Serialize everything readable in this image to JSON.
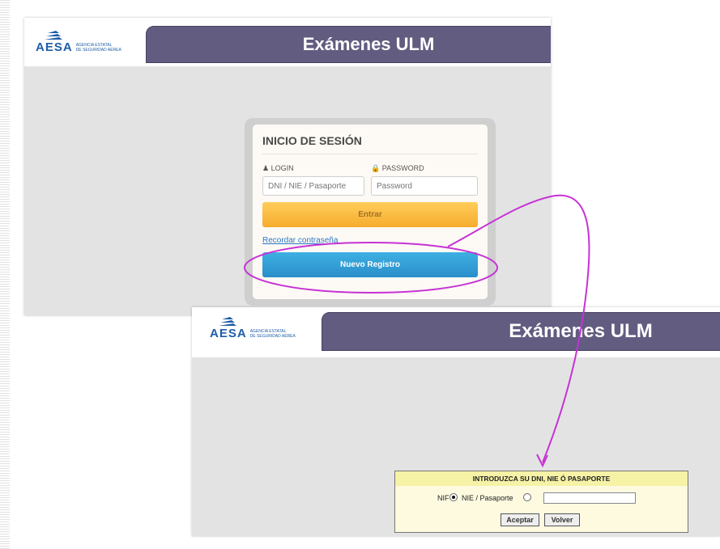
{
  "logo": {
    "word": "AESA",
    "subtitle_line1": "Agencia Estatal",
    "subtitle_line2": "de Seguridad Aérea"
  },
  "top_screen": {
    "title": "Exámenes ULM",
    "login": {
      "heading": "INICIO DE SESIÓN",
      "login_label": "LOGIN",
      "password_label": "PASSWORD",
      "login_placeholder": "DNI / NIE / Pasaporte",
      "password_placeholder": "Password",
      "enter_button": "Entrar",
      "forgot_link": "Recordar contraseña",
      "register_button": "Nuevo Registro"
    }
  },
  "bottom_screen": {
    "title": "Exámenes ULM",
    "form": {
      "heading": "INTRODUZCA SU DNI, NIE Ó PASAPORTE",
      "option_nif": "NIF",
      "option_nie": "NIE / Pasaporte",
      "selected_option": "NIF",
      "accept_button": "Aceptar",
      "back_button": "Volver"
    }
  },
  "annotation": {
    "color": "#c632d6",
    "shapes": [
      "ellipse around Nuevo Registro button",
      "arrow to DNI form"
    ]
  },
  "colors": {
    "title_bar": "#625c80",
    "enter_button": "#f6ac2d",
    "register_button": "#2a8ec9",
    "brand_blue": "#1e5da8"
  }
}
